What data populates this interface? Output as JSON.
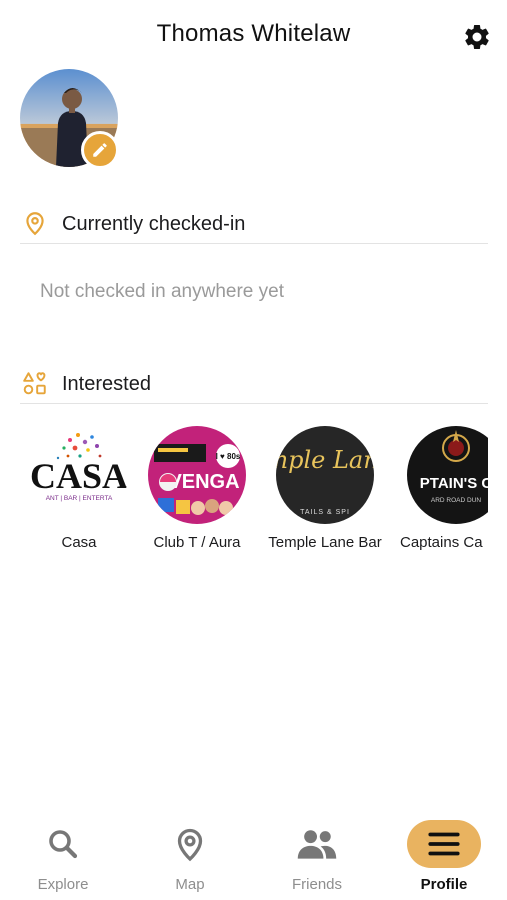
{
  "header": {
    "title": "Thomas Whitelaw",
    "settings_icon": "gear-icon"
  },
  "profile": {
    "avatar_alt": "",
    "edit_icon": "pencil-icon"
  },
  "checked_in": {
    "heading": "Currently checked-in",
    "icon": "location-pin-icon",
    "empty_message": "Not checked in anywhere yet"
  },
  "interested": {
    "heading": "Interested",
    "icon": "shapes-icon",
    "venues": [
      {
        "name": "Casa",
        "logo_text": "CASA",
        "logo_subtext": "ANT | BAR | ENTERTA"
      },
      {
        "name": "Club T / Aura",
        "logo_text": "VENGA",
        "logo_badge": "I ♥ 80s"
      },
      {
        "name": "Temple Lane Bar",
        "logo_text": "emple Lane",
        "logo_subtext": "TAILS & SPI"
      },
      {
        "name": "Captains Ca",
        "logo_text": "PTAIN'S C",
        "logo_subtext": "ARD ROAD DUN"
      }
    ]
  },
  "tabs": [
    {
      "label": "Explore",
      "icon": "search-icon"
    },
    {
      "label": "Map",
      "icon": "map-pin-icon"
    },
    {
      "label": "Friends",
      "icon": "friends-icon"
    },
    {
      "label": "Profile",
      "icon": "menu-icon",
      "active": true
    }
  ],
  "colors": {
    "accent": "#e9b360",
    "text_muted": "#9a9a9a",
    "icon_gray": "#777777"
  }
}
